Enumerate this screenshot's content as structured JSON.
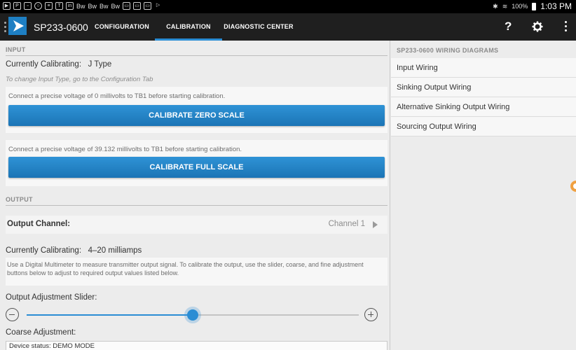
{
  "status_bar": {
    "left_icons": [
      "video-icon",
      "p-icon",
      "image-icon",
      "circle-icon",
      "ps-icon",
      "t-icon",
      "linkedin-icon",
      "bw-icon",
      "bw-icon",
      "bw-icon",
      "bw-icon",
      "card-icon",
      "card-icon",
      "card-icon",
      "play-icon"
    ],
    "left_icon_labels": [
      "Bw",
      "Bw",
      "Bw",
      "Bw"
    ],
    "battery_pct": "100%",
    "time": "1:03 PM"
  },
  "toolbar": {
    "app_title": "SP233-0600",
    "tabs": [
      {
        "label": "CONFIGURATION"
      },
      {
        "label": "CALIBRATION"
      },
      {
        "label": "DIAGNOSTIC CENTER"
      }
    ],
    "active_tab": "CALIBRATION",
    "help": "?",
    "accent": "#2a8dd4"
  },
  "input_section": {
    "header": "INPUT",
    "currently_calibrating_label": "Currently Calibrating:",
    "currently_calibrating_value": "J Type",
    "hint": "To change Input Type, go to the Configuration Tab",
    "zero_instruction": "Connect a precise voltage of 0 millivolts to TB1 before starting calibration.",
    "zero_button": "CALIBRATE ZERO SCALE",
    "full_instruction": "Connect a precise voltage of 39.132 millivolts to TB1 before starting calibration.",
    "full_button": "CALIBRATE FULL SCALE"
  },
  "output_section": {
    "header": "OUTPUT",
    "channel_label": "Output Channel:",
    "channel_value": "Channel 1",
    "currently_calibrating_label": "Currently Calibrating:",
    "currently_calibrating_value": "4–20 milliamps",
    "description": "Use a Digital Multimeter to measure transmitter output signal. To calibrate the output, use the slider, coarse, and fine adjustment buttons below to adjust to required output values listed below.",
    "slider_label": "Output Adjustment Slider:",
    "slider_value": 0.5,
    "coarse_label": "Coarse Adjustment:",
    "device_status": "Device status: DEMO MODE"
  },
  "wiring": {
    "header": "SP233-0600 WIRING DIAGRAMS",
    "items": [
      {
        "label": "Input Wiring"
      },
      {
        "label": "Sinking Output Wiring"
      },
      {
        "label": "Alternative Sinking Output Wiring"
      },
      {
        "label": "Sourcing Output Wiring"
      }
    ]
  }
}
